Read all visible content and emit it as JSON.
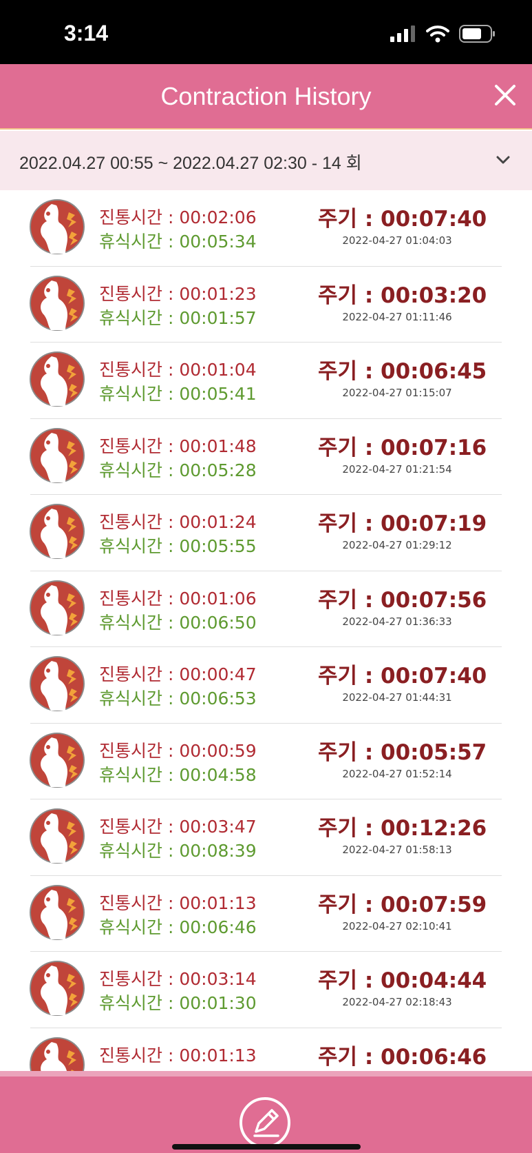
{
  "status_bar": {
    "time": "3:14"
  },
  "header": {
    "title": "Contraction History",
    "close_icon": "close-icon"
  },
  "range": {
    "text": "2022.04.27 00:55 ~ 2022.04.27 02:30 - 14 회"
  },
  "labels": {
    "contraction": "진통시간 : ",
    "rest": "휴식시간 : ",
    "period": "주기 : "
  },
  "colors": {
    "accent": "#e06d93",
    "contraction": "#b02a32",
    "rest": "#5e9a30",
    "period": "#8a1f22",
    "icon_bg": "#c0453a"
  },
  "records": [
    {
      "contraction": "00:02:06",
      "rest": "00:05:34",
      "period": "00:07:40",
      "timestamp": "2022-04-27 01:04:03"
    },
    {
      "contraction": "00:01:23",
      "rest": "00:01:57",
      "period": "00:03:20",
      "timestamp": "2022-04-27 01:11:46"
    },
    {
      "contraction": "00:01:04",
      "rest": "00:05:41",
      "period": "00:06:45",
      "timestamp": "2022-04-27 01:15:07"
    },
    {
      "contraction": "00:01:48",
      "rest": "00:05:28",
      "period": "00:07:16",
      "timestamp": "2022-04-27 01:21:54"
    },
    {
      "contraction": "00:01:24",
      "rest": "00:05:55",
      "period": "00:07:19",
      "timestamp": "2022-04-27 01:29:12"
    },
    {
      "contraction": "00:01:06",
      "rest": "00:06:50",
      "period": "00:07:56",
      "timestamp": "2022-04-27 01:36:33"
    },
    {
      "contraction": "00:00:47",
      "rest": "00:06:53",
      "period": "00:07:40",
      "timestamp": "2022-04-27 01:44:31"
    },
    {
      "contraction": "00:00:59",
      "rest": "00:04:58",
      "period": "00:05:57",
      "timestamp": "2022-04-27 01:52:14"
    },
    {
      "contraction": "00:03:47",
      "rest": "00:08:39",
      "period": "00:12:26",
      "timestamp": "2022-04-27 01:58:13"
    },
    {
      "contraction": "00:01:13",
      "rest": "00:06:46",
      "period": "00:07:59",
      "timestamp": "2022-04-27 02:10:41"
    },
    {
      "contraction": "00:03:14",
      "rest": "00:01:30",
      "period": "00:04:44",
      "timestamp": "2022-04-27 02:18:43"
    },
    {
      "contraction": "00:01:13",
      "rest": "",
      "period": "00:06:46",
      "timestamp": ""
    }
  ],
  "footer": {
    "edit_icon": "pencil-icon"
  }
}
